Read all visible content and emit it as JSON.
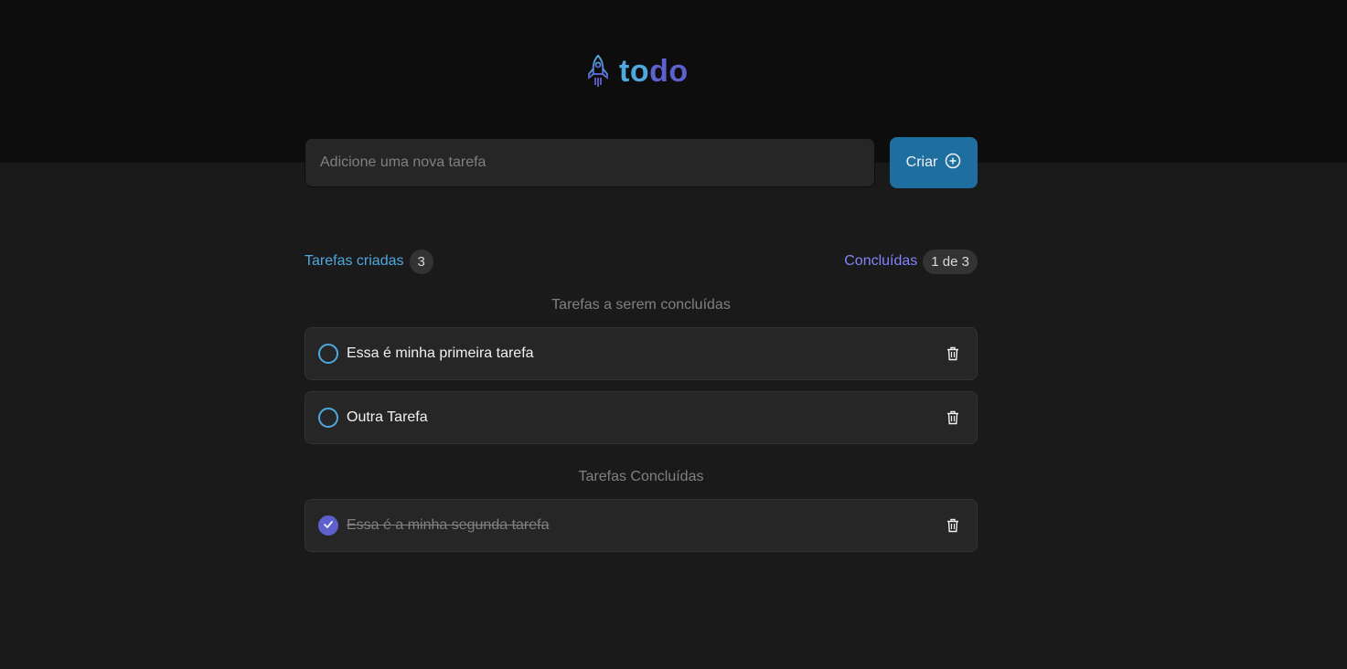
{
  "header": {
    "logo_icon": "rocket-icon",
    "logo_part1": "to",
    "logo_part2": "do",
    "colors": {
      "blue": "#4ea8de",
      "purple": "#5e60ce"
    }
  },
  "new_task": {
    "placeholder": "Adicione uma nova tarefa",
    "value": "",
    "create_label": "Criar",
    "create_icon": "plus-circle-icon"
  },
  "counters": {
    "created_label": "Tarefas criadas",
    "created_count": "3",
    "done_label": "Concluídas",
    "done_count": "1 de 3"
  },
  "sections": {
    "pending_title": "Tarefas a serem concluídas",
    "done_title": "Tarefas Concluídas"
  },
  "tasks": [
    {
      "text": "Essa é minha primeira tarefa",
      "done": false
    },
    {
      "text": "Outra Tarefa",
      "done": false
    },
    {
      "text": "Essa é a minha segunda tarefa",
      "done": true
    }
  ]
}
